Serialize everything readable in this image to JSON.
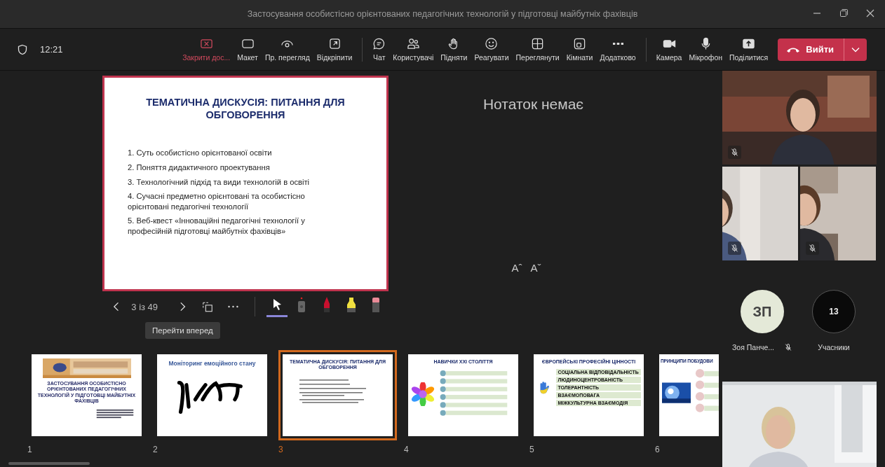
{
  "window": {
    "title": "Застосування особистісно орієнтованих педагогічних технологій у підготовці майбутніх фахівців"
  },
  "toolbar": {
    "time": "12:21",
    "buttons": [
      {
        "kind": "stop_share",
        "label": "Закрити дос..."
      },
      {
        "kind": "layout",
        "label": "Макет"
      },
      {
        "kind": "preview",
        "label": "Пр. перегляд"
      },
      {
        "kind": "undock",
        "label": "Відкріпити"
      },
      {
        "kind": "chat",
        "label": "Чат"
      },
      {
        "kind": "people",
        "label": "Користувачі"
      },
      {
        "kind": "raise",
        "label": "Підняти"
      },
      {
        "kind": "react",
        "label": "Реагувати"
      },
      {
        "kind": "view",
        "label": "Переглянути"
      },
      {
        "kind": "rooms",
        "label": "Кімнати"
      },
      {
        "kind": "more",
        "label": "Додатково"
      }
    ],
    "devices": [
      {
        "kind": "camera",
        "label": "Камера"
      },
      {
        "kind": "mic",
        "label": "Мікрофон"
      },
      {
        "kind": "share",
        "label": "Поділитися"
      }
    ],
    "leave": {
      "label": "Вийти"
    }
  },
  "slide": {
    "title": "ТЕМАТИЧНА ДИСКУСІЯ: ПИТАННЯ ДЛЯ ОБГОВОРЕННЯ",
    "items": [
      {
        "number": "1.",
        "lines": [
          "Суть особистісно орієнтованої освіти"
        ]
      },
      {
        "number": "2.",
        "lines": [
          "Поняття дидактичного проектування"
        ]
      },
      {
        "number": "3.",
        "lines": [
          " Технологічний підхід та види технологій в  освіті"
        ]
      },
      {
        "number": "4.",
        "lines": [
          "Сучасні предметно орієнтовані та особистісно",
          "орієнтовані педагогічні технології"
        ]
      },
      {
        "number": "5.",
        "lines": [
          "Веб-квест «Інноваційні педагогічні технології у",
          "професійній підготовці майбутніх фахівців»"
        ]
      }
    ]
  },
  "presenter_controls": {
    "counter": "3 із 49",
    "tooltip": "Перейти вперед",
    "tools": [
      {
        "kind": "pointer",
        "selected": true
      },
      {
        "kind": "laser",
        "selected": false
      },
      {
        "kind": "pen",
        "selected": false
      },
      {
        "kind": "highlighter",
        "selected": false
      },
      {
        "kind": "eraser",
        "selected": false
      }
    ]
  },
  "notes": {
    "text": "Нотаток немає",
    "font_buttons": [
      "Aˆ",
      "Aˇ"
    ]
  },
  "videos": [
    {
      "kind": "picture",
      "muted": true
    },
    {
      "kind": "picture",
      "muted": true
    },
    {
      "kind": "picture",
      "muted": true
    }
  ],
  "avatar": {
    "initials": "ЗП",
    "name": "Зоя Панче...",
    "muted": true
  },
  "participants": {
    "count": "13",
    "label": "Учасники"
  },
  "self_video": {
    "kind": "picture",
    "muted": false
  },
  "thumbnails": [
    {
      "number": "1",
      "selected": false,
      "kind": "title_slide",
      "title": "ЗАСТОСУВАННЯ ОСОБИСТІСНО ОРІЄНТОВАНИХ ПЕДАГОГІЧНИХ ТЕХНОЛОГІЙ У ПІДГОТОВЦІ МАЙБУТНІХ ФАХІВЦІВ"
    },
    {
      "number": "2",
      "selected": false,
      "kind": "drawing",
      "title": "Моніторинг емоційного стану"
    },
    {
      "number": "3",
      "selected": true,
      "kind": "list",
      "title": "ТЕМАТИЧНА ДИСКУСІЯ: ПИТАННЯ ДЛЯ ОБГОВОРЕННЯ"
    },
    {
      "number": "4",
      "selected": false,
      "kind": "skills",
      "title": "НАВИЧКИ ХХІ СТОЛІТТЯ"
    },
    {
      "number": "5",
      "selected": false,
      "kind": "values",
      "title": "ЄВРОПЕЙСЬКІ ПРОФЕСІЙНІ ЦІННОСТІ",
      "items": [
        "СОЦІАЛЬНА ВІДПОВІДАЛЬНІСТЬ",
        "ЛЮДИНОЦЕНТРОВАНІСТЬ",
        "ТОЛЕРАНТНІСТЬ",
        "ВЗАЄМОПОВАГА",
        "МІЖКУЛЬТУРНА ВЗАЄМОДІЯ"
      ]
    },
    {
      "number": "6",
      "selected": false,
      "kind": "diagram",
      "title": "ПРИНЦИПИ ПОБУДОВИ"
    }
  ]
}
